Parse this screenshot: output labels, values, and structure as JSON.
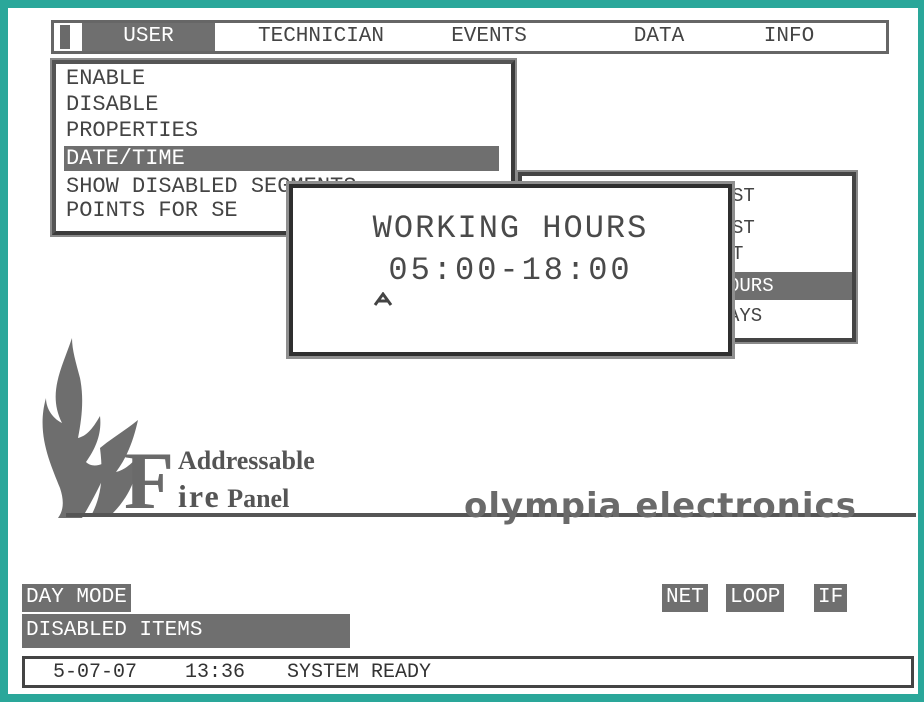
{
  "menu": {
    "items": [
      "USER",
      "TECHNICIAN",
      "EVENTS",
      "DATA",
      "INFO"
    ],
    "active": "USER"
  },
  "dropdown": {
    "items": [
      "ENABLE",
      "DISABLE",
      "PROPERTIES",
      "DATE/TIME",
      "SHOW DISABLED SEGMENTS",
      "POINTS FOR SE"
    ],
    "selected": "DATE/TIME"
  },
  "submenu": {
    "items": [
      "ST",
      "ST",
      "T",
      "OURS",
      "AYS"
    ],
    "selected": "OURS"
  },
  "dialog": {
    "title": "WORKING HOURS",
    "value": "05:00-18:00",
    "caret": "^"
  },
  "logo": {
    "letter": "F",
    "line1": "Addressable",
    "line2_initial": "ire",
    "line2_rest": "Panel",
    "brand": "olympia electronics"
  },
  "indicators": {
    "mode": "DAY MODE",
    "disabled": "DISABLED ITEMS",
    "net": "NET",
    "loop": "LOOP",
    "if": "IF"
  },
  "status": {
    "date": "5-07-07",
    "time": "13:36",
    "message": "SYSTEM READY"
  },
  "colors": {
    "frame": "#2aa79a",
    "highlight": "#6f6f6f",
    "text": "#4a4a4a",
    "background": "#ffffff"
  }
}
